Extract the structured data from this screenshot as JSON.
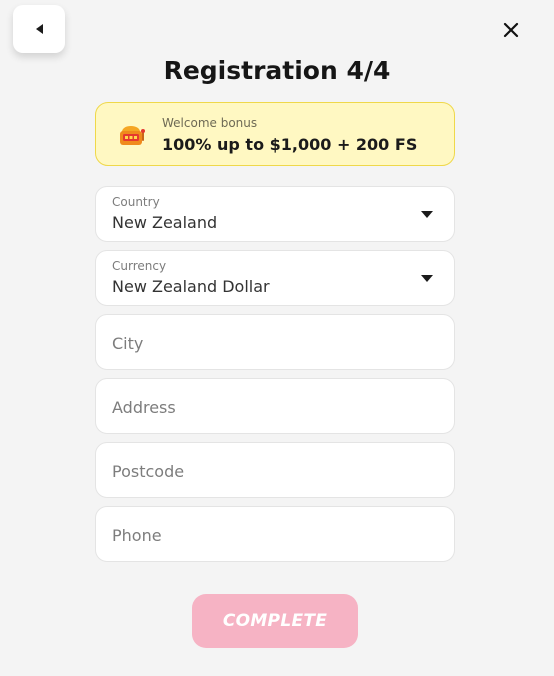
{
  "header": {
    "title": "Registration 4/4",
    "back_icon": "caret-left-icon",
    "close_icon": "close-icon"
  },
  "bonus": {
    "icon": "slot-machine-icon",
    "label": "Welcome bonus",
    "value": "100% up to $1,000 + 200 FS",
    "bg_color": "#fff8c2",
    "border_color": "#efd84a"
  },
  "form": {
    "country": {
      "label": "Country",
      "value": "New Zealand"
    },
    "currency": {
      "label": "Currency",
      "value": "New Zealand Dollar"
    },
    "city": {
      "placeholder": "City"
    },
    "address": {
      "placeholder": "Address"
    },
    "postcode": {
      "placeholder": "Postcode"
    },
    "phone": {
      "placeholder": "Phone"
    }
  },
  "actions": {
    "complete_label": "COMPLETE",
    "complete_color": "#f6b3c4"
  }
}
